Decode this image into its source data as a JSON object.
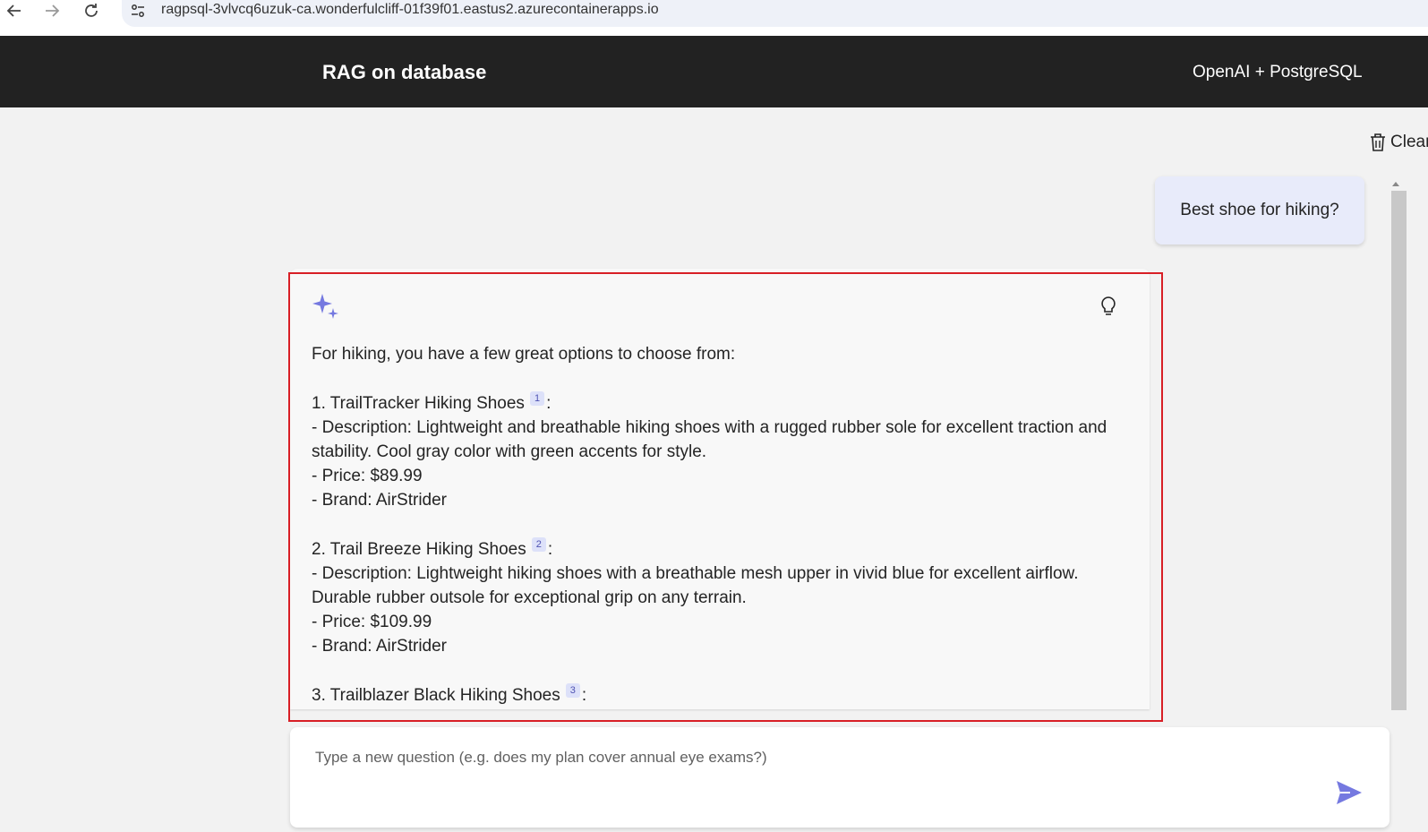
{
  "browser": {
    "url": "ragpsql-3vlvcq6uzuk-ca.wonderfulcliff-01f39f01.eastus2.azurecontainerapps.io"
  },
  "header": {
    "title": "RAG on database",
    "subtitle": "OpenAI + PostgreSQL"
  },
  "toolbar": {
    "clear_label": "Clear"
  },
  "chat": {
    "user_question": "Best shoe for hiking?",
    "answer": {
      "intro": "For hiking, you have a few great options to choose from:",
      "items": [
        {
          "heading": "1. TrailTracker Hiking Shoes",
          "citation": "1",
          "description": "- Description: Lightweight and breathable hiking shoes with a rugged rubber sole for excellent traction and stability. Cool gray color with green accents for style.",
          "price": "- Price: $89.99",
          "brand": "- Brand: AirStrider"
        },
        {
          "heading": "2. Trail Breeze Hiking Shoes",
          "citation": "2",
          "description": "- Description: Lightweight hiking shoes with a breathable mesh upper in vivid blue for excellent airflow. Durable rubber outsole for exceptional grip on any terrain.",
          "price": "- Price: $109.99",
          "brand": "- Brand: AirStrider"
        },
        {
          "heading": "3. Trailblazer Black Hiking Shoes",
          "citation": "3"
        }
      ]
    }
  },
  "input": {
    "placeholder": "Type a new question (e.g. does my plan cover annual eye exams?)"
  },
  "icons": {
    "back": "arrow-left-icon",
    "forward": "arrow-right-icon",
    "reload": "reload-icon",
    "site_info": "tune-icon",
    "clear": "trash-icon",
    "sparkle": "sparkle-icon",
    "thought_process": "lightbulb-icon",
    "send": "send-icon"
  },
  "colors": {
    "header_bg": "#222222",
    "accent": "#7579e0",
    "user_bubble": "#e8ebfa",
    "highlight_border": "#d81f26"
  }
}
